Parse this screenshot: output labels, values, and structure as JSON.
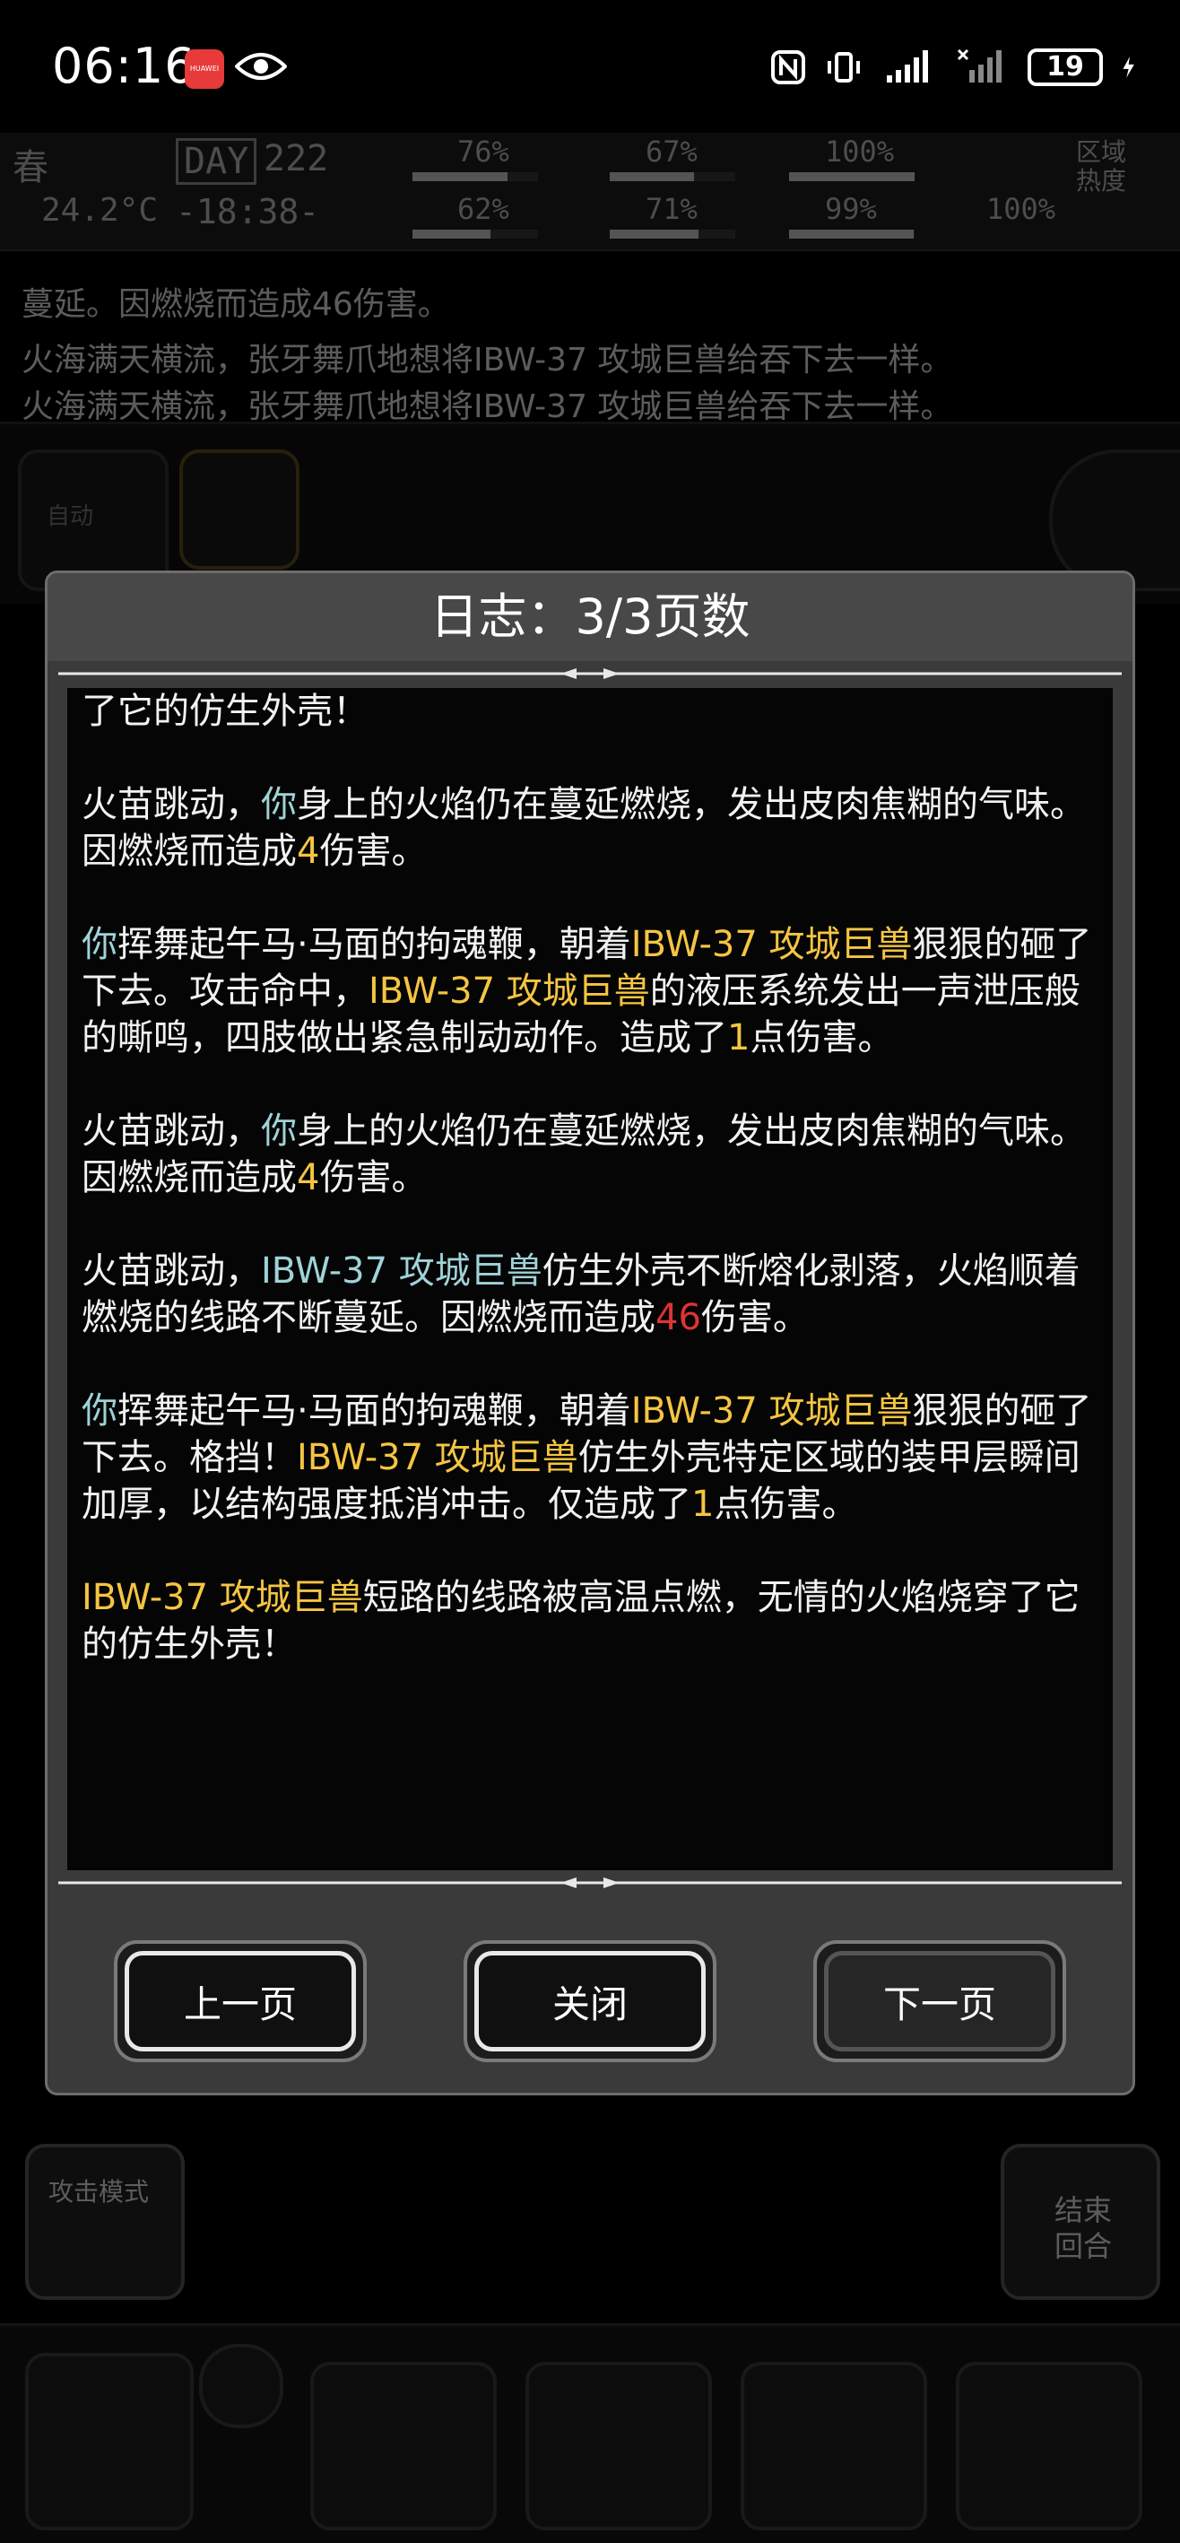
{
  "status_bar": {
    "time": "06:16",
    "app_badge": "HUAWEI",
    "battery": "19"
  },
  "hud": {
    "season": "春",
    "day_label": "DAY",
    "day": "222",
    "temperature": "24.2°C",
    "clock": "-18:38-",
    "stats": [
      "76%",
      "67%",
      "100%",
      "62%",
      "71%",
      "99%",
      "100%"
    ],
    "zone_heat": "区域热度"
  },
  "background_log": [
    "蔓延。因燃烧而造成46伤害。",
    "火海满天横流，张牙舞爪地想将IBW-37 攻城巨兽给吞下去一样。",
    "火海满天横流，张牙舞爪地想将IBW-37 攻城巨兽给吞下去一样。"
  ],
  "background_buttons": {
    "auto": "自动",
    "attack_mode": "攻击模式",
    "end_turn": "结束回合"
  },
  "dialog": {
    "title": "日志：3/3页数",
    "entries": [
      [
        {
          "t": "了它的仿生外壳！",
          "c": ""
        }
      ],
      [
        {
          "t": "火苗跳动，",
          "c": ""
        },
        {
          "t": "你",
          "c": "blue"
        },
        {
          "t": "身上的火焰仍在蔓延燃烧，发出皮肉焦糊的气味。因燃烧而造成",
          "c": ""
        },
        {
          "t": "4",
          "c": "yellow"
        },
        {
          "t": "伤害。",
          "c": ""
        }
      ],
      [
        {
          "t": "你",
          "c": "blue"
        },
        {
          "t": "挥舞起午马·马面的拘魂鞭，朝着",
          "c": ""
        },
        {
          "t": "IBW-37 攻城巨兽",
          "c": "yellow"
        },
        {
          "t": "狠狠的砸了下去。攻击命中，",
          "c": ""
        },
        {
          "t": "IBW-37 攻城巨兽",
          "c": "yellow"
        },
        {
          "t": "的液压系统发出一声泄压般的嘶鸣，四肢做出紧急制动动作。造成了",
          "c": ""
        },
        {
          "t": "1",
          "c": "yellow"
        },
        {
          "t": "点伤害。",
          "c": ""
        }
      ],
      [
        {
          "t": "火苗跳动，",
          "c": ""
        },
        {
          "t": "你",
          "c": "blue"
        },
        {
          "t": "身上的火焰仍在蔓延燃烧，发出皮肉焦糊的气味。因燃烧而造成",
          "c": ""
        },
        {
          "t": "4",
          "c": "yellow"
        },
        {
          "t": "伤害。",
          "c": ""
        }
      ],
      [
        {
          "t": "火苗跳动，",
          "c": ""
        },
        {
          "t": "IBW-37 攻城巨兽",
          "c": "blue"
        },
        {
          "t": "仿生外壳不断熔化剥落，火焰顺着燃烧的线路不断蔓延。因燃烧而造成",
          "c": ""
        },
        {
          "t": "46",
          "c": "red"
        },
        {
          "t": "伤害。",
          "c": ""
        }
      ],
      [
        {
          "t": "你",
          "c": "blue"
        },
        {
          "t": "挥舞起午马·马面的拘魂鞭，朝着",
          "c": ""
        },
        {
          "t": "IBW-37 攻城巨兽",
          "c": "yellow"
        },
        {
          "t": "狠狠的砸了下去。格挡！",
          "c": ""
        },
        {
          "t": "IBW-37 攻城巨兽",
          "c": "yellow"
        },
        {
          "t": "仿生外壳特定区域的装甲层瞬间加厚，以结构强度抵消冲击。仅造成了",
          "c": ""
        },
        {
          "t": "1",
          "c": "yellow"
        },
        {
          "t": "点伤害。",
          "c": ""
        }
      ],
      [
        {
          "t": "IBW-37 攻城巨兽",
          "c": "yellow"
        },
        {
          "t": "短路的线路被高温点燃，无情的火焰烧穿了它的仿生外壳！",
          "c": ""
        }
      ]
    ],
    "buttons": {
      "prev": "上一页",
      "close": "关闭",
      "next": "下一页"
    }
  }
}
